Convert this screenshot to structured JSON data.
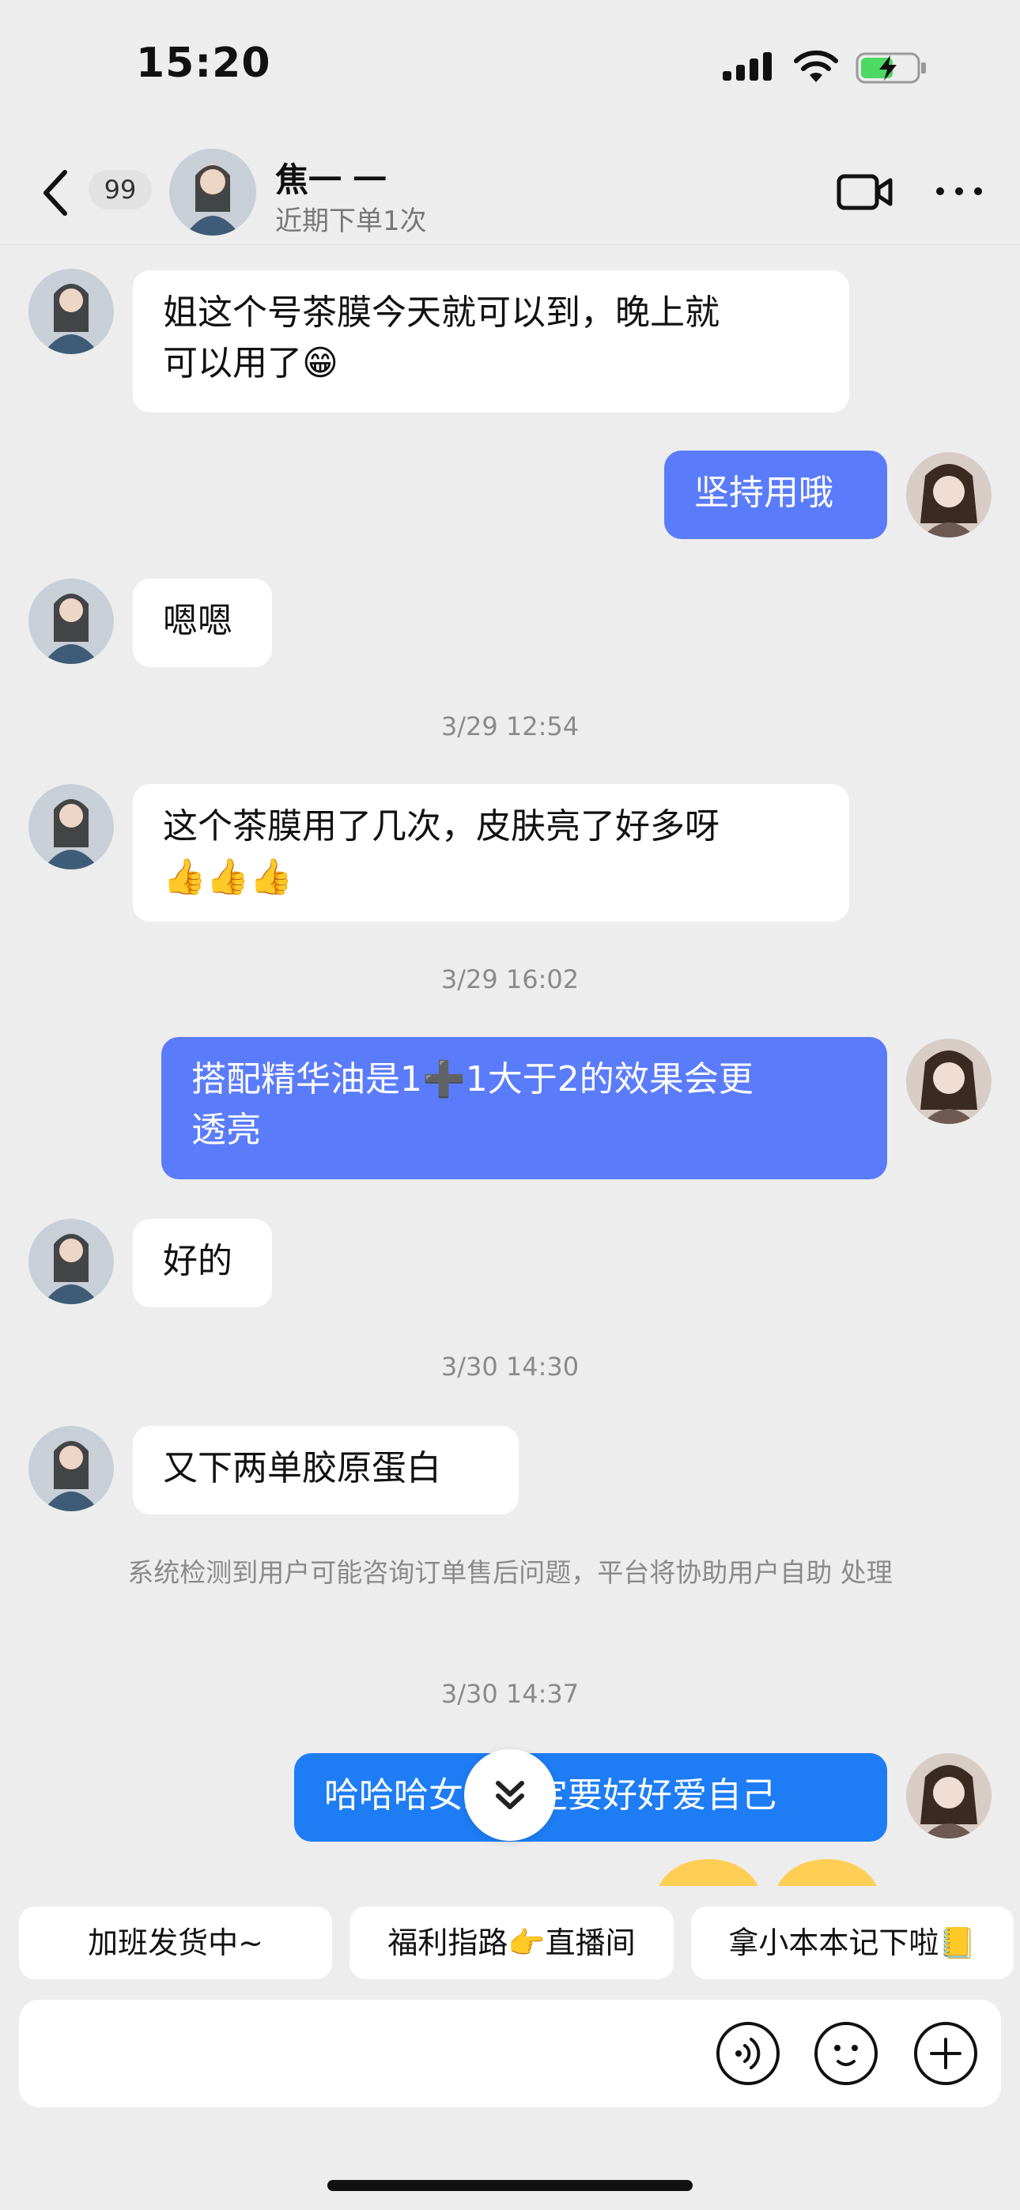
{
  "status_bar": {
    "time": "15:20"
  },
  "header": {
    "unread_count": "99",
    "contact_name": "焦一 一",
    "contact_subtitle": "近期下单1次"
  },
  "messages": [
    {
      "side": "in",
      "text": "姐这个号茶膜今天就可以到，晚上就\n可以用了😁"
    },
    {
      "side": "out",
      "text": "坚持用哦"
    },
    {
      "side": "in",
      "text": "嗯嗯"
    },
    {
      "type": "timestamp",
      "text": "3/29 12:54"
    },
    {
      "side": "in",
      "text": "这个茶膜用了几次，皮肤亮了好多呀\n👍👍👍"
    },
    {
      "type": "timestamp",
      "text": "3/29 16:02"
    },
    {
      "side": "out",
      "text": "搭配精华油是1➕1大于2的效果会更\n透亮"
    },
    {
      "side": "in",
      "text": "好的"
    },
    {
      "type": "timestamp",
      "text": "3/30 14:30"
    },
    {
      "side": "in",
      "text": "又下两单胶原蛋白"
    },
    {
      "type": "system",
      "text": "系统检测到用户可能咨询订单售后问题，平台将协助用户自助\n处理"
    },
    {
      "type": "timestamp",
      "text": "3/30 14:37"
    },
    {
      "side": "out",
      "text": "哈哈哈女人一定要好好爱自己"
    }
  ],
  "quick_replies": [
    "加班发货中~",
    "福利指路👉直播间",
    "拿小本本记下啦📒"
  ],
  "colors": {
    "background": "#EDEDED",
    "outgoing_bubble": "#5B7CFA",
    "outgoing_bubble_latest": "#1E7DF5",
    "incoming_bubble": "#FFFFFF"
  },
  "icons": [
    "back-icon",
    "video-call-icon",
    "more-icon",
    "chevron-double-down-icon",
    "voice-icon",
    "emoji-icon",
    "plus-icon"
  ]
}
